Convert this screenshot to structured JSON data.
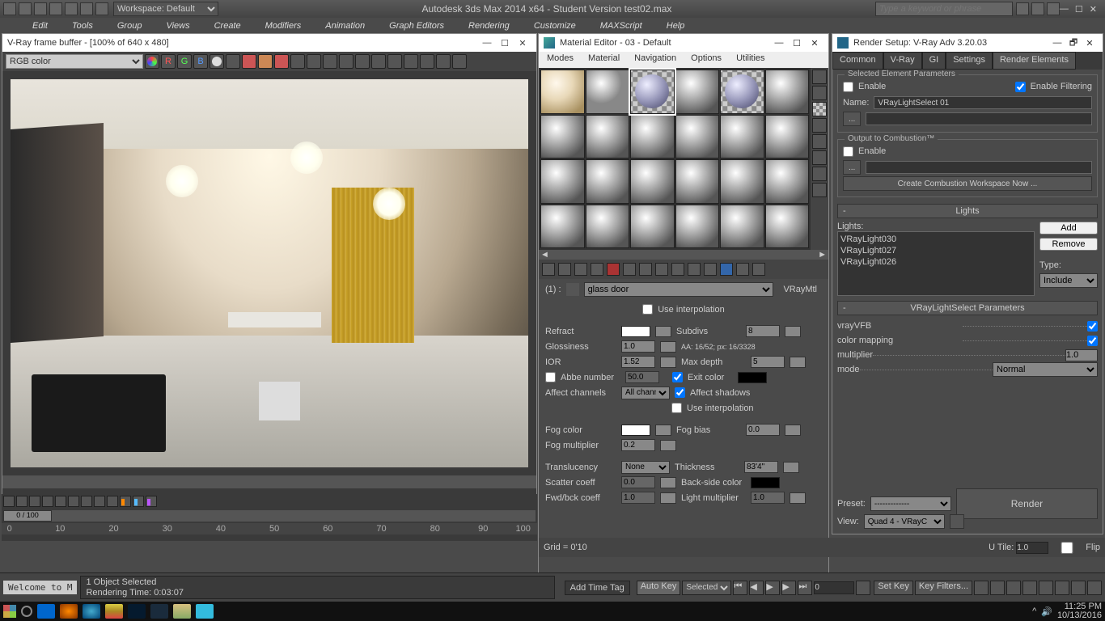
{
  "app": {
    "workspace_label": "Workspace: Default",
    "title": "Autodesk 3ds Max  2014 x64 -  Student Version   test02.max",
    "search_placeholder": "Type a keyword or phrase"
  },
  "menu": [
    "Edit",
    "Tools",
    "Group",
    "Views",
    "Create",
    "Modifiers",
    "Animation",
    "Graph Editors",
    "Rendering",
    "Customize",
    "MAXScript",
    "Help"
  ],
  "vfb": {
    "title": "V-Ray frame buffer - [100% of 640 x 480]",
    "channel": "RGB color",
    "rgb_buttons": [
      "R",
      "G",
      "B"
    ]
  },
  "material_editor": {
    "title": "Material Editor - 03 - Default",
    "menus": [
      "Modes",
      "Material",
      "Navigation",
      "Options",
      "Utilities"
    ],
    "slot_label": "(1) :",
    "material_name": "glass door",
    "material_type": "VRayMtl",
    "use_interp": "Use interpolation",
    "refract": {
      "label": "Refract",
      "color": "#ffffff"
    },
    "glossiness": {
      "label": "Glossiness",
      "value": "1.0"
    },
    "ior": {
      "label": "IOR",
      "value": "1.52"
    },
    "abbe": {
      "label": "Abbe number",
      "value": "50.0"
    },
    "affect_channels": {
      "label": "Affect channels",
      "value": "All channe"
    },
    "subdivs": {
      "label": "Subdivs",
      "value": "8"
    },
    "aa_info": "AA: 16/52; px: 16/3328",
    "max_depth": {
      "label": "Max depth",
      "value": "5"
    },
    "exit_color": {
      "label": "Exit color",
      "color": "#000000"
    },
    "affect_shadows": "Affect shadows",
    "use_interp2": "Use interpolation",
    "fog_color": {
      "label": "Fog color",
      "color": "#ffffff"
    },
    "fog_mult": {
      "label": "Fog multiplier",
      "value": "0.2"
    },
    "fog_bias": {
      "label": "Fog bias",
      "value": "0.0"
    },
    "translucency": {
      "label": "Translucency",
      "value": "None"
    },
    "scatter": {
      "label": "Scatter coeff",
      "value": "0.0"
    },
    "fwdbck": {
      "label": "Fwd/bck coeff",
      "value": "1.0"
    },
    "thickness": {
      "label": "Thickness",
      "value": "83'4\""
    },
    "backside": {
      "label": "Back-side color",
      "color": "#000000"
    },
    "lightmult": {
      "label": "Light multiplier",
      "value": "1.0"
    }
  },
  "render_setup": {
    "title": "Render Setup: V-Ray Adv 3.20.03",
    "tabs": [
      "Common",
      "V-Ray",
      "GI",
      "Settings",
      "Render Elements"
    ],
    "sel_params": {
      "title": "Selected Element Parameters",
      "enable": "Enable",
      "enable_filtering": "Enable Filtering",
      "name_label": "Name:",
      "name_value": "VRayLightSelect 01"
    },
    "combustion": {
      "title": "Output to Combustion™",
      "enable": "Enable",
      "button": "Create Combustion Workspace Now ..."
    },
    "lights_rollout": {
      "header": "Lights",
      "label": "Lights:",
      "items": [
        "VRayLight030",
        "VRayLight027",
        "VRayLight026"
      ],
      "add": "Add",
      "remove": "Remove",
      "type_label": "Type:",
      "type_value": "Include"
    },
    "vls_rollout": {
      "header": "VRayLightSelect Parameters",
      "vrayVFB": "vrayVFB",
      "color_mapping": "color mapping",
      "multiplier_label": "multiplier",
      "multiplier_value": "1.0",
      "mode_label": "mode",
      "mode_value": "Normal"
    },
    "bottom": {
      "preset_label": "Preset:",
      "view_label": "View:",
      "view_value": "Quad 4 - VRayC",
      "render_button": "Render"
    }
  },
  "timeline": {
    "pos": "0 / 100",
    "ticks": [
      "0",
      "10",
      "20",
      "30",
      "40",
      "50",
      "60",
      "70",
      "80",
      "90",
      "100"
    ]
  },
  "status": {
    "welcome": "Welcome to M",
    "selected": "1 Object Selected",
    "render_time": "Rendering Time: 0:03:07",
    "grid": "Grid = 0'10",
    "autokey": "Auto Key",
    "setkey": "Set Key",
    "selected_filter": "Selected",
    "keyfilters": "Key Filters...",
    "add_time_tag": "Add Time Tag",
    "utile_label": "U Tile:",
    "utile_value": "1.0",
    "flip": "Flip"
  },
  "taskbar": {
    "time": "11:25 PM",
    "date": "10/13/2016"
  }
}
